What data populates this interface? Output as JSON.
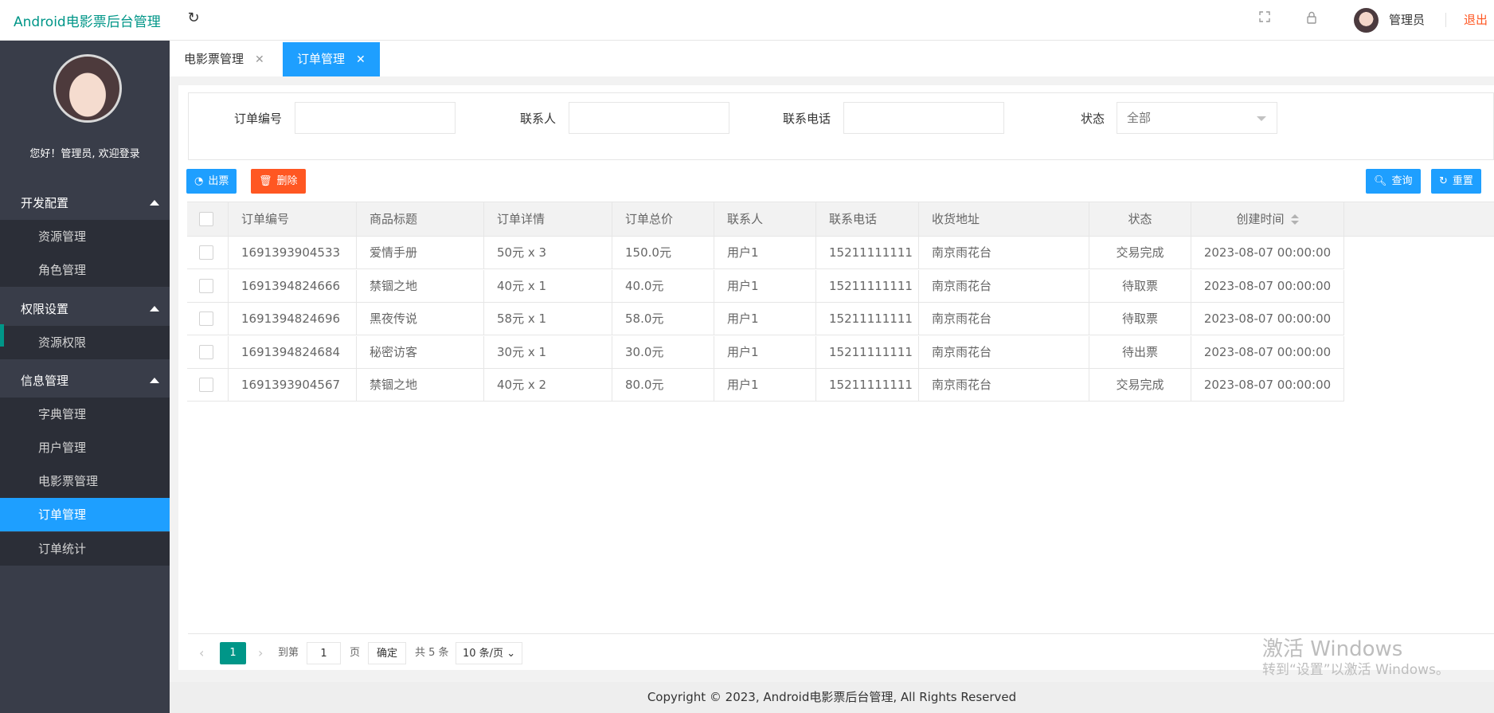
{
  "header": {
    "brand": "Android电影票后台管理",
    "admin_name": "管理员",
    "logout": "退出",
    "icons": [
      "refresh-icon",
      "fullscreen-icon",
      "lock-icon"
    ]
  },
  "sidebar": {
    "welcome": "您好！管理员, 欢迎登录",
    "groups": [
      {
        "label": "开发配置",
        "items": [
          "资源管理",
          "角色管理"
        ]
      },
      {
        "label": "权限设置",
        "items": [
          "资源权限"
        ]
      },
      {
        "label": "信息管理",
        "items": [
          "字典管理",
          "用户管理",
          "电影票管理",
          "订单管理",
          "订单统计"
        ]
      }
    ],
    "active_item": "订单管理"
  },
  "tabs": [
    {
      "label": "电影票管理",
      "active": false
    },
    {
      "label": "订单管理",
      "active": true
    }
  ],
  "search": {
    "order_no_label": "订单编号",
    "contact_label": "联系人",
    "phone_label": "联系电话",
    "status_label": "状态",
    "status_value": "全部"
  },
  "toolbar": {
    "issue_ticket": "出票",
    "delete": "删除",
    "query": "查询",
    "reset": "重置"
  },
  "table": {
    "columns": [
      "订单编号",
      "商品标题",
      "订单详情",
      "订单总价",
      "联系人",
      "联系电话",
      "收货地址",
      "状态",
      "创建时间"
    ],
    "rows": [
      [
        "1691393904533",
        "爱情手册",
        "50元 x 3",
        "150.0元",
        "用户1",
        "15211111111",
        "南京雨花台",
        "交易完成",
        "2023-08-07 00:00:00"
      ],
      [
        "1691394824666",
        "禁锢之地",
        "40元 x 1",
        "40.0元",
        "用户1",
        "15211111111",
        "南京雨花台",
        "待取票",
        "2023-08-07 00:00:00"
      ],
      [
        "1691394824696",
        "黑夜传说",
        "58元 x 1",
        "58.0元",
        "用户1",
        "15211111111",
        "南京雨花台",
        "待取票",
        "2023-08-07 00:00:00"
      ],
      [
        "1691394824684",
        "秘密访客",
        "30元 x 1",
        "30.0元",
        "用户1",
        "15211111111",
        "南京雨花台",
        "待出票",
        "2023-08-07 00:00:00"
      ],
      [
        "1691393904567",
        "禁锢之地",
        "40元 x 2",
        "80.0元",
        "用户1",
        "15211111111",
        "南京雨花台",
        "交易完成",
        "2023-08-07 00:00:00"
      ]
    ]
  },
  "pagination": {
    "current": "1",
    "goto_label": "到第",
    "page_input": "1",
    "page_suffix": "页",
    "confirm": "确定",
    "total": "共 5 条",
    "page_size": "10 条/页"
  },
  "watermark": {
    "line1": "激活 Windows",
    "line2": "转到“设置”以激活 Windows。"
  },
  "footer": "Copyright © 2023, Android电影票后台管理, All Rights Reserved"
}
